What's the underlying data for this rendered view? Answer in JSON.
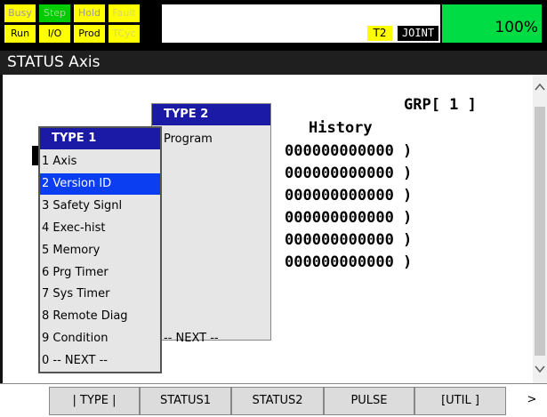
{
  "status_lamps": {
    "top": [
      {
        "label": "Busy",
        "bg": "#ffff00",
        "fg": "#9a9a9a"
      },
      {
        "label": "Step",
        "bg": "#00cc00",
        "fg": "#8fdc8f"
      },
      {
        "label": "Hold",
        "bg": "#ffff00",
        "fg": "#9a9a9a"
      },
      {
        "label": "Fault",
        "bg": "#ffff00",
        "fg": "#d8d860"
      }
    ],
    "bottom": [
      {
        "label": "Run",
        "bg": "#ffff00",
        "fg": "#000000"
      },
      {
        "label": "I/O",
        "bg": "#ffff00",
        "fg": "#000000"
      },
      {
        "label": "Prod",
        "bg": "#ffff00",
        "fg": "#000000"
      },
      {
        "label": "TCyc",
        "bg": "#ffff00",
        "fg": "#d8d860"
      }
    ]
  },
  "mode": {
    "teach": "T2",
    "coord": "JOINT",
    "override": "100%"
  },
  "title": "STATUS Axis",
  "content": {
    "grp": "GRP[ 1 ]",
    "history_label": "History",
    "dashes": "--",
    "rows": [
      "000000000000 )",
      "000000000000 )",
      "000000000000 )",
      "000000000000 )",
      "000000000000 )",
      "000000000000 )"
    ]
  },
  "popup_type2": {
    "header": "TYPE   2",
    "items": [
      "Program",
      "-- NEXT --"
    ]
  },
  "popup_type1": {
    "header": "TYPE    1",
    "selected_index": 1,
    "items": [
      "1 Axis",
      "2 Version ID",
      "3 Safety Signl",
      "4 Exec-hist",
      "5 Memory",
      "6 Prg Timer",
      "7 Sys Timer",
      "8 Remote Diag",
      "9 Condition",
      "0 -- NEXT --"
    ]
  },
  "function_keys": [
    "| TYPE |",
    "STATUS1",
    "STATUS2",
    "PULSE",
    "[UTIL ]"
  ],
  "next_key": ">",
  "icons": {
    "scroll_up": "^",
    "scroll_down": "v"
  }
}
